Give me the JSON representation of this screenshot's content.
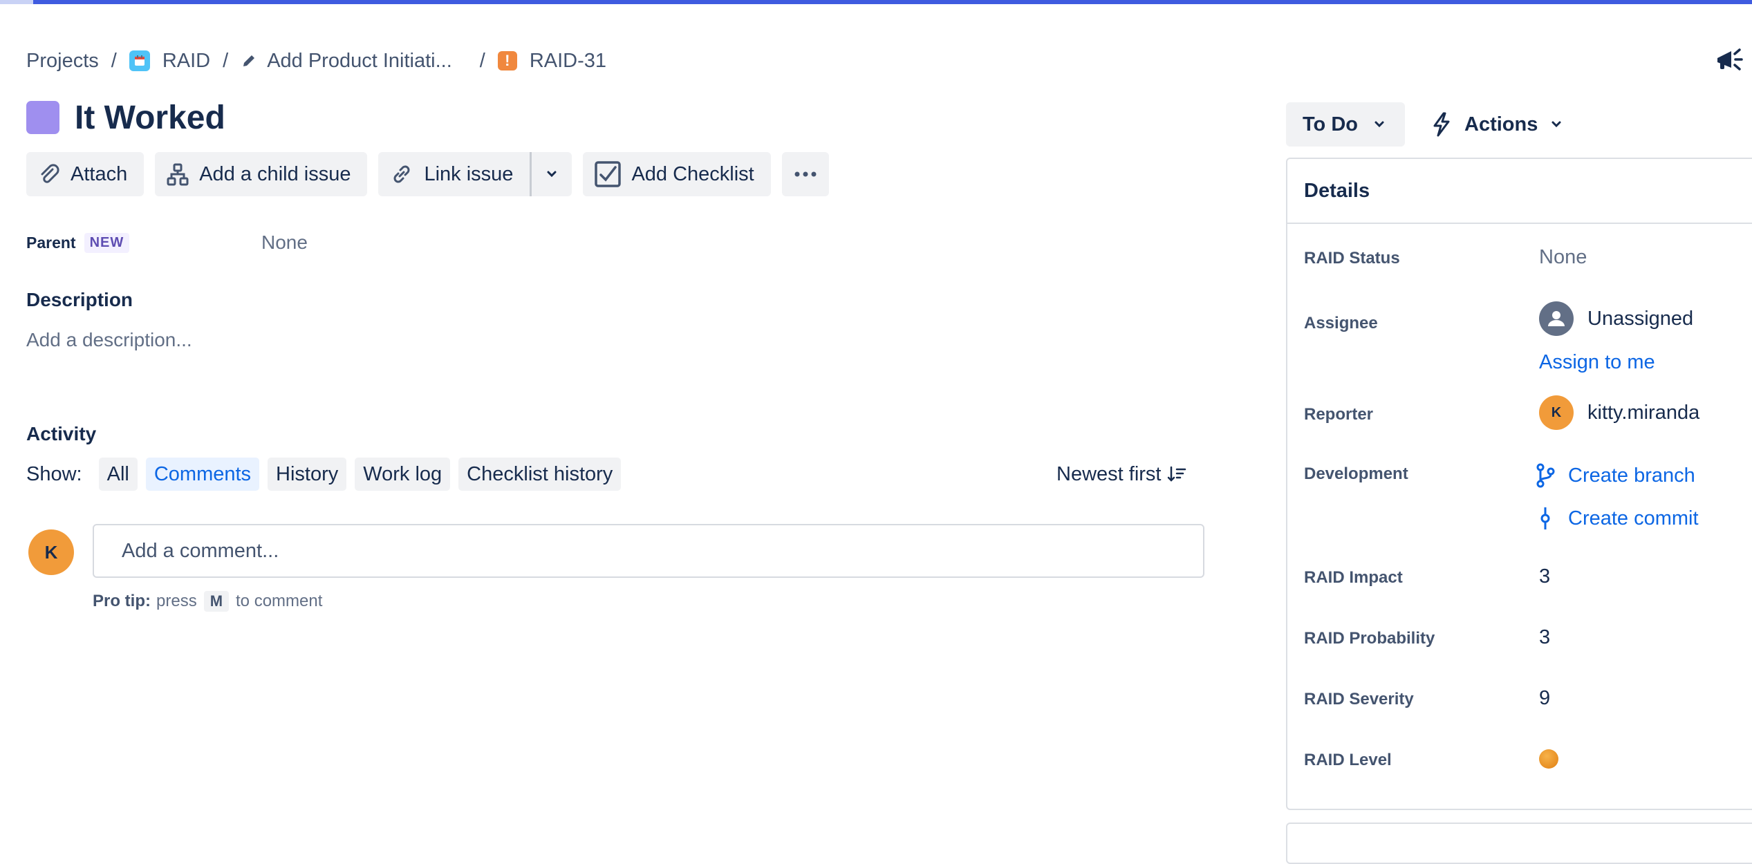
{
  "breadcrumb": {
    "projects": "Projects",
    "project": "RAID",
    "initiative": "Add Product Initiati...",
    "issue_key": "RAID-31",
    "separator": "/"
  },
  "issue": {
    "title": "It Worked",
    "type_color": "#9f8fef"
  },
  "toolbar": {
    "attach": "Attach",
    "add_child": "Add a child issue",
    "link_issue": "Link issue",
    "add_checklist": "Add Checklist"
  },
  "parent": {
    "label": "Parent",
    "badge": "NEW",
    "value": "None"
  },
  "description": {
    "heading": "Description",
    "placeholder": "Add a description..."
  },
  "activity": {
    "heading": "Activity",
    "show_label": "Show:",
    "filters": [
      "All",
      "Comments",
      "History",
      "Work log",
      "Checklist history"
    ],
    "active_filter": "Comments",
    "sort": "Newest first",
    "avatar_initial": "K",
    "comment_placeholder": "Add a comment...",
    "protip_label": "Pro tip:",
    "protip_pre": "press",
    "protip_key": "M",
    "protip_post": "to comment"
  },
  "status": {
    "label": "To Do"
  },
  "actions": {
    "label": "Actions"
  },
  "details": {
    "heading": "Details",
    "raid_status": {
      "label": "RAID Status",
      "value": "None"
    },
    "assignee": {
      "label": "Assignee",
      "value": "Unassigned",
      "assign_link": "Assign to me"
    },
    "reporter": {
      "label": "Reporter",
      "value": "kitty.miranda",
      "initial": "K"
    },
    "development": {
      "label": "Development",
      "branch": "Create branch",
      "commit": "Create commit"
    },
    "raid_impact": {
      "label": "RAID Impact",
      "value": "3"
    },
    "raid_probability": {
      "label": "RAID Probability",
      "value": "3"
    },
    "raid_severity": {
      "label": "RAID Severity",
      "value": "9"
    },
    "raid_level": {
      "label": "RAID Level",
      "color": "#f0931f"
    }
  },
  "colors": {
    "accent": "#0c66e4",
    "topbar": "#3f5be0",
    "avatar": "#f19b3a"
  }
}
